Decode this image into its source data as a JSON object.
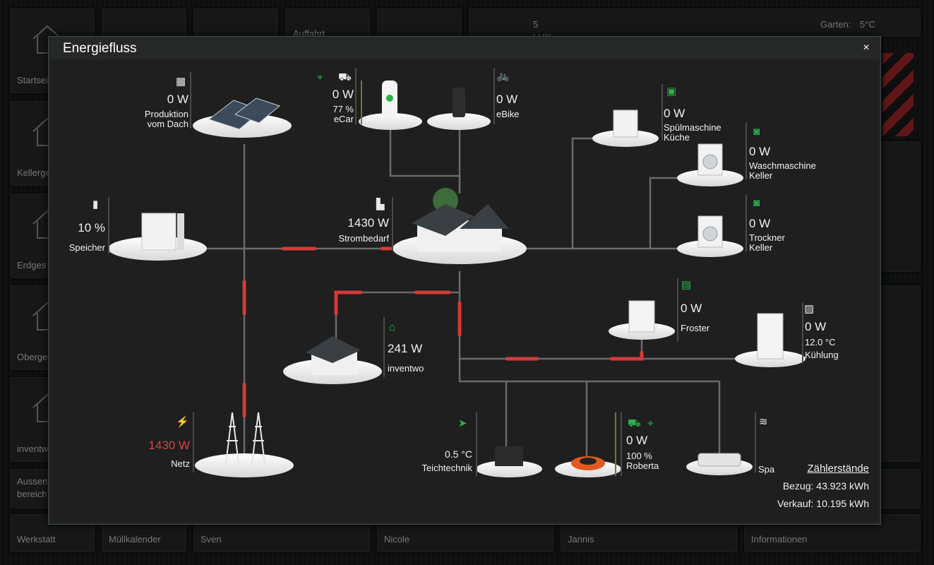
{
  "background": {
    "tiles": [
      "Startsei",
      "Kellerge",
      "Erdges",
      "Oberge",
      "inventw",
      "Aussen",
      "bereich",
      "Werkstatt",
      "Müllkalender",
      "Sven",
      "Nicole",
      "Jannis",
      "Informationen",
      "Auffahrt"
    ],
    "weather": {
      "lux_value": "5",
      "lux_unit": "LUX"
    },
    "temps": {
      "garden_label": "Garten:",
      "garden_value": "5°C"
    }
  },
  "modal": {
    "title": "Energiefluss",
    "close": "×"
  },
  "nodes": {
    "roof": {
      "value": "0 W",
      "label1": "Produktion",
      "label2": "vom Dach"
    },
    "ecar": {
      "value": "0 W",
      "soc": "77 %",
      "label": "eCar"
    },
    "ebike": {
      "value": "0 W",
      "label": "eBike"
    },
    "storage": {
      "value": "10 %",
      "label": "Speicher"
    },
    "house": {
      "value": "1430 W",
      "label": "Strombedarf"
    },
    "inventwo": {
      "value": "241 W",
      "label": "inventwo"
    },
    "grid": {
      "value": "1430 W",
      "label": "Netz"
    },
    "dishwasher": {
      "value": "0 W",
      "label1": "Spülmaschine",
      "label2": "Küche"
    },
    "washer": {
      "value": "0 W",
      "label1": "Waschmaschine",
      "label2": "Keller"
    },
    "dryer": {
      "value": "0 W",
      "label1": "Trockner",
      "label2": "Keller"
    },
    "freezer": {
      "value": "0 W",
      "label": "Froster"
    },
    "fridge": {
      "value": "0 W",
      "temp": "12.0 °C",
      "label": "Kühlung"
    },
    "pond": {
      "temp": "0.5 °C",
      "label": "Teichtechnik"
    },
    "mower": {
      "value": "0 W",
      "soc": "100 %",
      "label": "Roberta"
    },
    "spa": {
      "label": "Spa"
    }
  },
  "counters": {
    "title": "Zählerstände",
    "bezug": "Bezug: 43.923 kWh",
    "verkauf": "Verkauf: 10.195 kWh"
  },
  "colors": {
    "flow_active": "#d13b3b",
    "line": "#6a6a6a",
    "accent_green": "#2bb34a",
    "grid_red": "#d24545"
  }
}
